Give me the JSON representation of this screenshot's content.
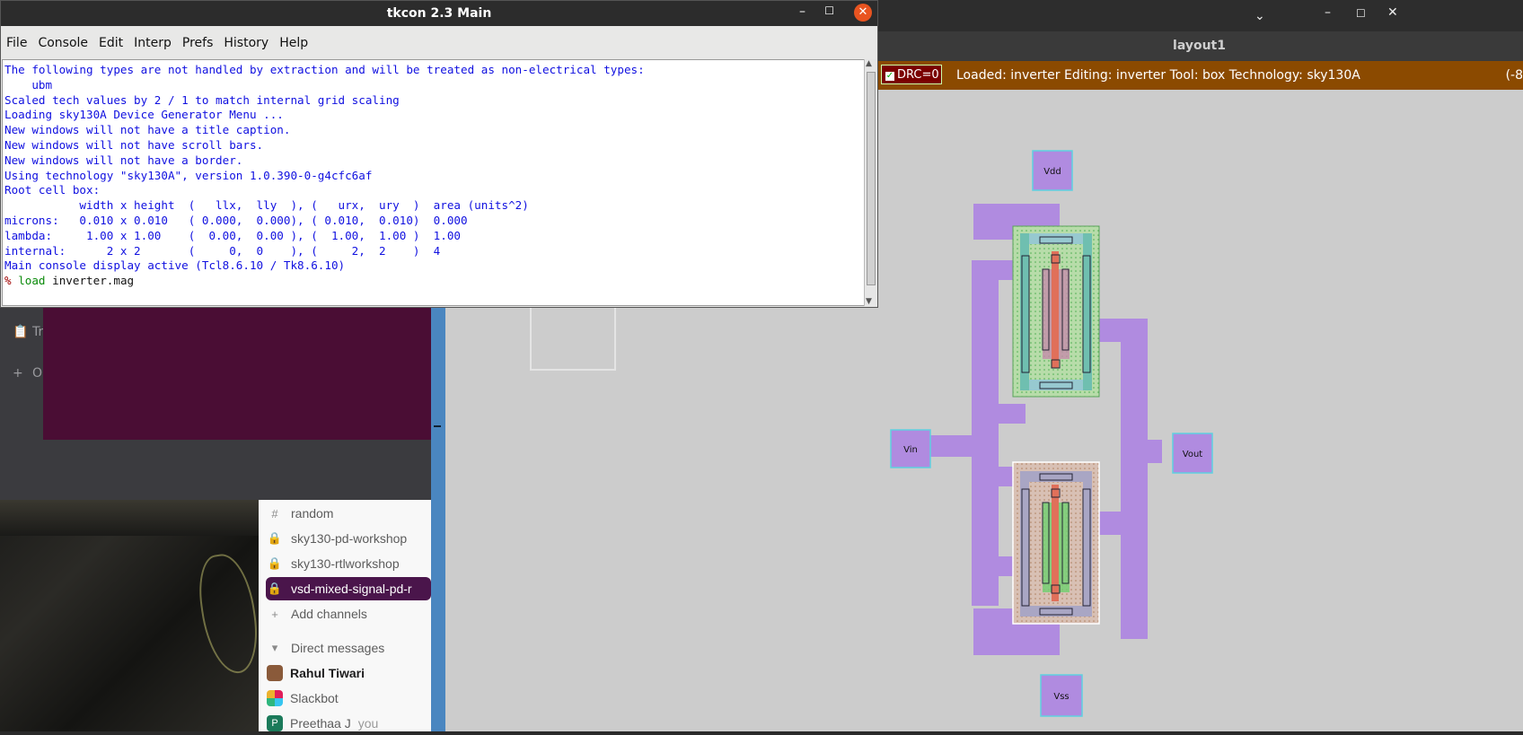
{
  "tkcon": {
    "title": "tkcon 2.3 Main",
    "menu": [
      "File",
      "Console",
      "Edit",
      "Interp",
      "Prefs",
      "History",
      "Help"
    ],
    "console_lines": [
      "The following types are not handled by extraction and will be treated as non-electrical types:",
      "    ubm",
      "Scaled tech values by 2 / 1 to match internal grid scaling",
      "Loading sky130A Device Generator Menu ...",
      "New windows will not have a title caption.",
      "New windows will not have scroll bars.",
      "New windows will not have a border.",
      "Using technology \"sky130A\", version 1.0.390-0-g4cfc6af",
      "Root cell box:",
      "           width x height  (   llx,  lly  ), (   urx,  ury  )  area (units^2)",
      "",
      "microns:   0.010 x 0.010   ( 0.000,  0.000), ( 0.010,  0.010)  0.000",
      "lambda:     1.00 x 1.00    (  0.00,  0.00 ), (  1.00,  1.00 )  1.00",
      "internal:      2 x 2       (     0,  0    ), (     2,  2    )  4",
      "Main console display active (Tcl8.6.10 / Tk8.6.10)"
    ],
    "prompt_symbol": "%",
    "prompt_command": "load",
    "prompt_arg": "inverter.mag"
  },
  "magic": {
    "window_title": "layout1",
    "drc_label": "DRC=0",
    "status": "Loaded: inverter Editing: inverter Tool: box  Technology: sky130A",
    "coords": "(-8",
    "pins": {
      "vdd": "Vdd",
      "vss": "Vss",
      "vin": "Vin",
      "vout": "Vout"
    }
  },
  "slack": {
    "partial_labels": [
      "Tr",
      "O"
    ],
    "channels": [
      {
        "icon": "#",
        "label": "random"
      },
      {
        "icon": "lock",
        "label": "sky130-pd-workshop"
      },
      {
        "icon": "lock",
        "label": "sky130-rtlworkshop"
      },
      {
        "icon": "lock",
        "label": "vsd-mixed-signal-pd-r"
      }
    ],
    "add_channels": "Add channels",
    "dm_header": "Direct messages",
    "dms": [
      {
        "label": "Rahul Tiwari"
      },
      {
        "label": "Slackbot"
      },
      {
        "label": "Preethaa J",
        "suffix": "you"
      }
    ]
  },
  "colors": {
    "metal": "#b08be0",
    "status_bar": "#8b4a00",
    "drc_box": "#7a0000",
    "active_channel": "#4a154b",
    "console_text": "#1010e0"
  }
}
